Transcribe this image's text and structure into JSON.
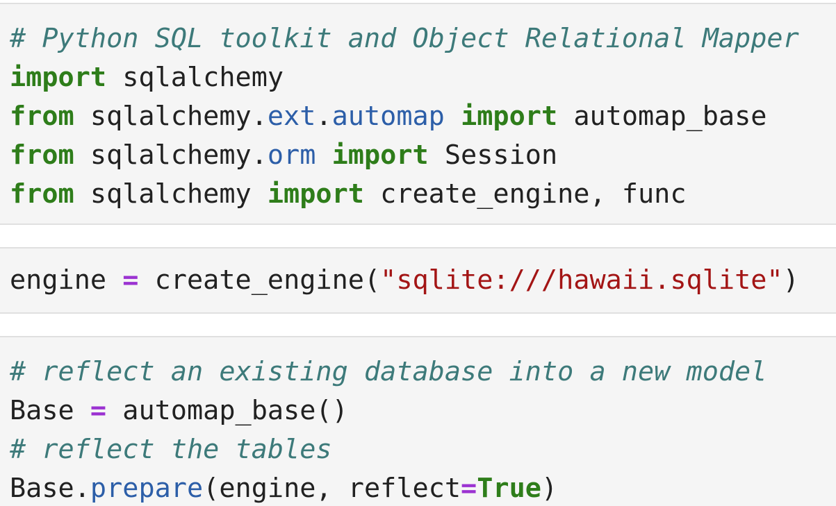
{
  "colors": {
    "cell_background": "#f5f5f5",
    "cell_border": "#e0e0e0",
    "comment": "#3d7a7a",
    "keyword": "#2e7d1a",
    "attribute": "#2c5ea8",
    "operator": "#9b32d1",
    "string": "#a31515",
    "text": "#212121"
  },
  "cells": [
    {
      "lines": [
        [
          {
            "type": "comment",
            "text": "# Python SQL toolkit and Object Relational Mapper"
          }
        ],
        [
          {
            "type": "keyword",
            "text": "import"
          },
          {
            "type": "text",
            "text": " sqlalchemy"
          }
        ],
        [
          {
            "type": "keyword",
            "text": "from"
          },
          {
            "type": "text",
            "text": " sqlalchemy."
          },
          {
            "type": "attr",
            "text": "ext"
          },
          {
            "type": "text",
            "text": "."
          },
          {
            "type": "attr",
            "text": "automap"
          },
          {
            "type": "text",
            "text": " "
          },
          {
            "type": "keyword",
            "text": "import"
          },
          {
            "type": "text",
            "text": " automap_base"
          }
        ],
        [
          {
            "type": "keyword",
            "text": "from"
          },
          {
            "type": "text",
            "text": " sqlalchemy."
          },
          {
            "type": "attr",
            "text": "orm"
          },
          {
            "type": "text",
            "text": " "
          },
          {
            "type": "keyword",
            "text": "import"
          },
          {
            "type": "text",
            "text": " Session"
          }
        ],
        [
          {
            "type": "keyword",
            "text": "from"
          },
          {
            "type": "text",
            "text": " sqlalchemy "
          },
          {
            "type": "keyword",
            "text": "import"
          },
          {
            "type": "text",
            "text": " create_engine, func"
          }
        ]
      ]
    },
    {
      "lines": [
        [
          {
            "type": "text",
            "text": "engine "
          },
          {
            "type": "operator",
            "text": "="
          },
          {
            "type": "text",
            "text": " create_engine("
          },
          {
            "type": "string",
            "text": "\"sqlite:///hawaii.sqlite\""
          },
          {
            "type": "text",
            "text": ")"
          }
        ]
      ]
    },
    {
      "lines": [
        [
          {
            "type": "comment",
            "text": "# reflect an existing database into a new model"
          }
        ],
        [
          {
            "type": "text",
            "text": "Base "
          },
          {
            "type": "operator",
            "text": "="
          },
          {
            "type": "text",
            "text": " automap_base()"
          }
        ],
        [
          {
            "type": "comment",
            "text": "# reflect the tables"
          }
        ],
        [
          {
            "type": "text",
            "text": "Base."
          },
          {
            "type": "attr",
            "text": "prepare"
          },
          {
            "type": "text",
            "text": "(engine, reflect"
          },
          {
            "type": "operator",
            "text": "="
          },
          {
            "type": "kwconst",
            "text": "True"
          },
          {
            "type": "text",
            "text": ")"
          }
        ]
      ]
    }
  ]
}
